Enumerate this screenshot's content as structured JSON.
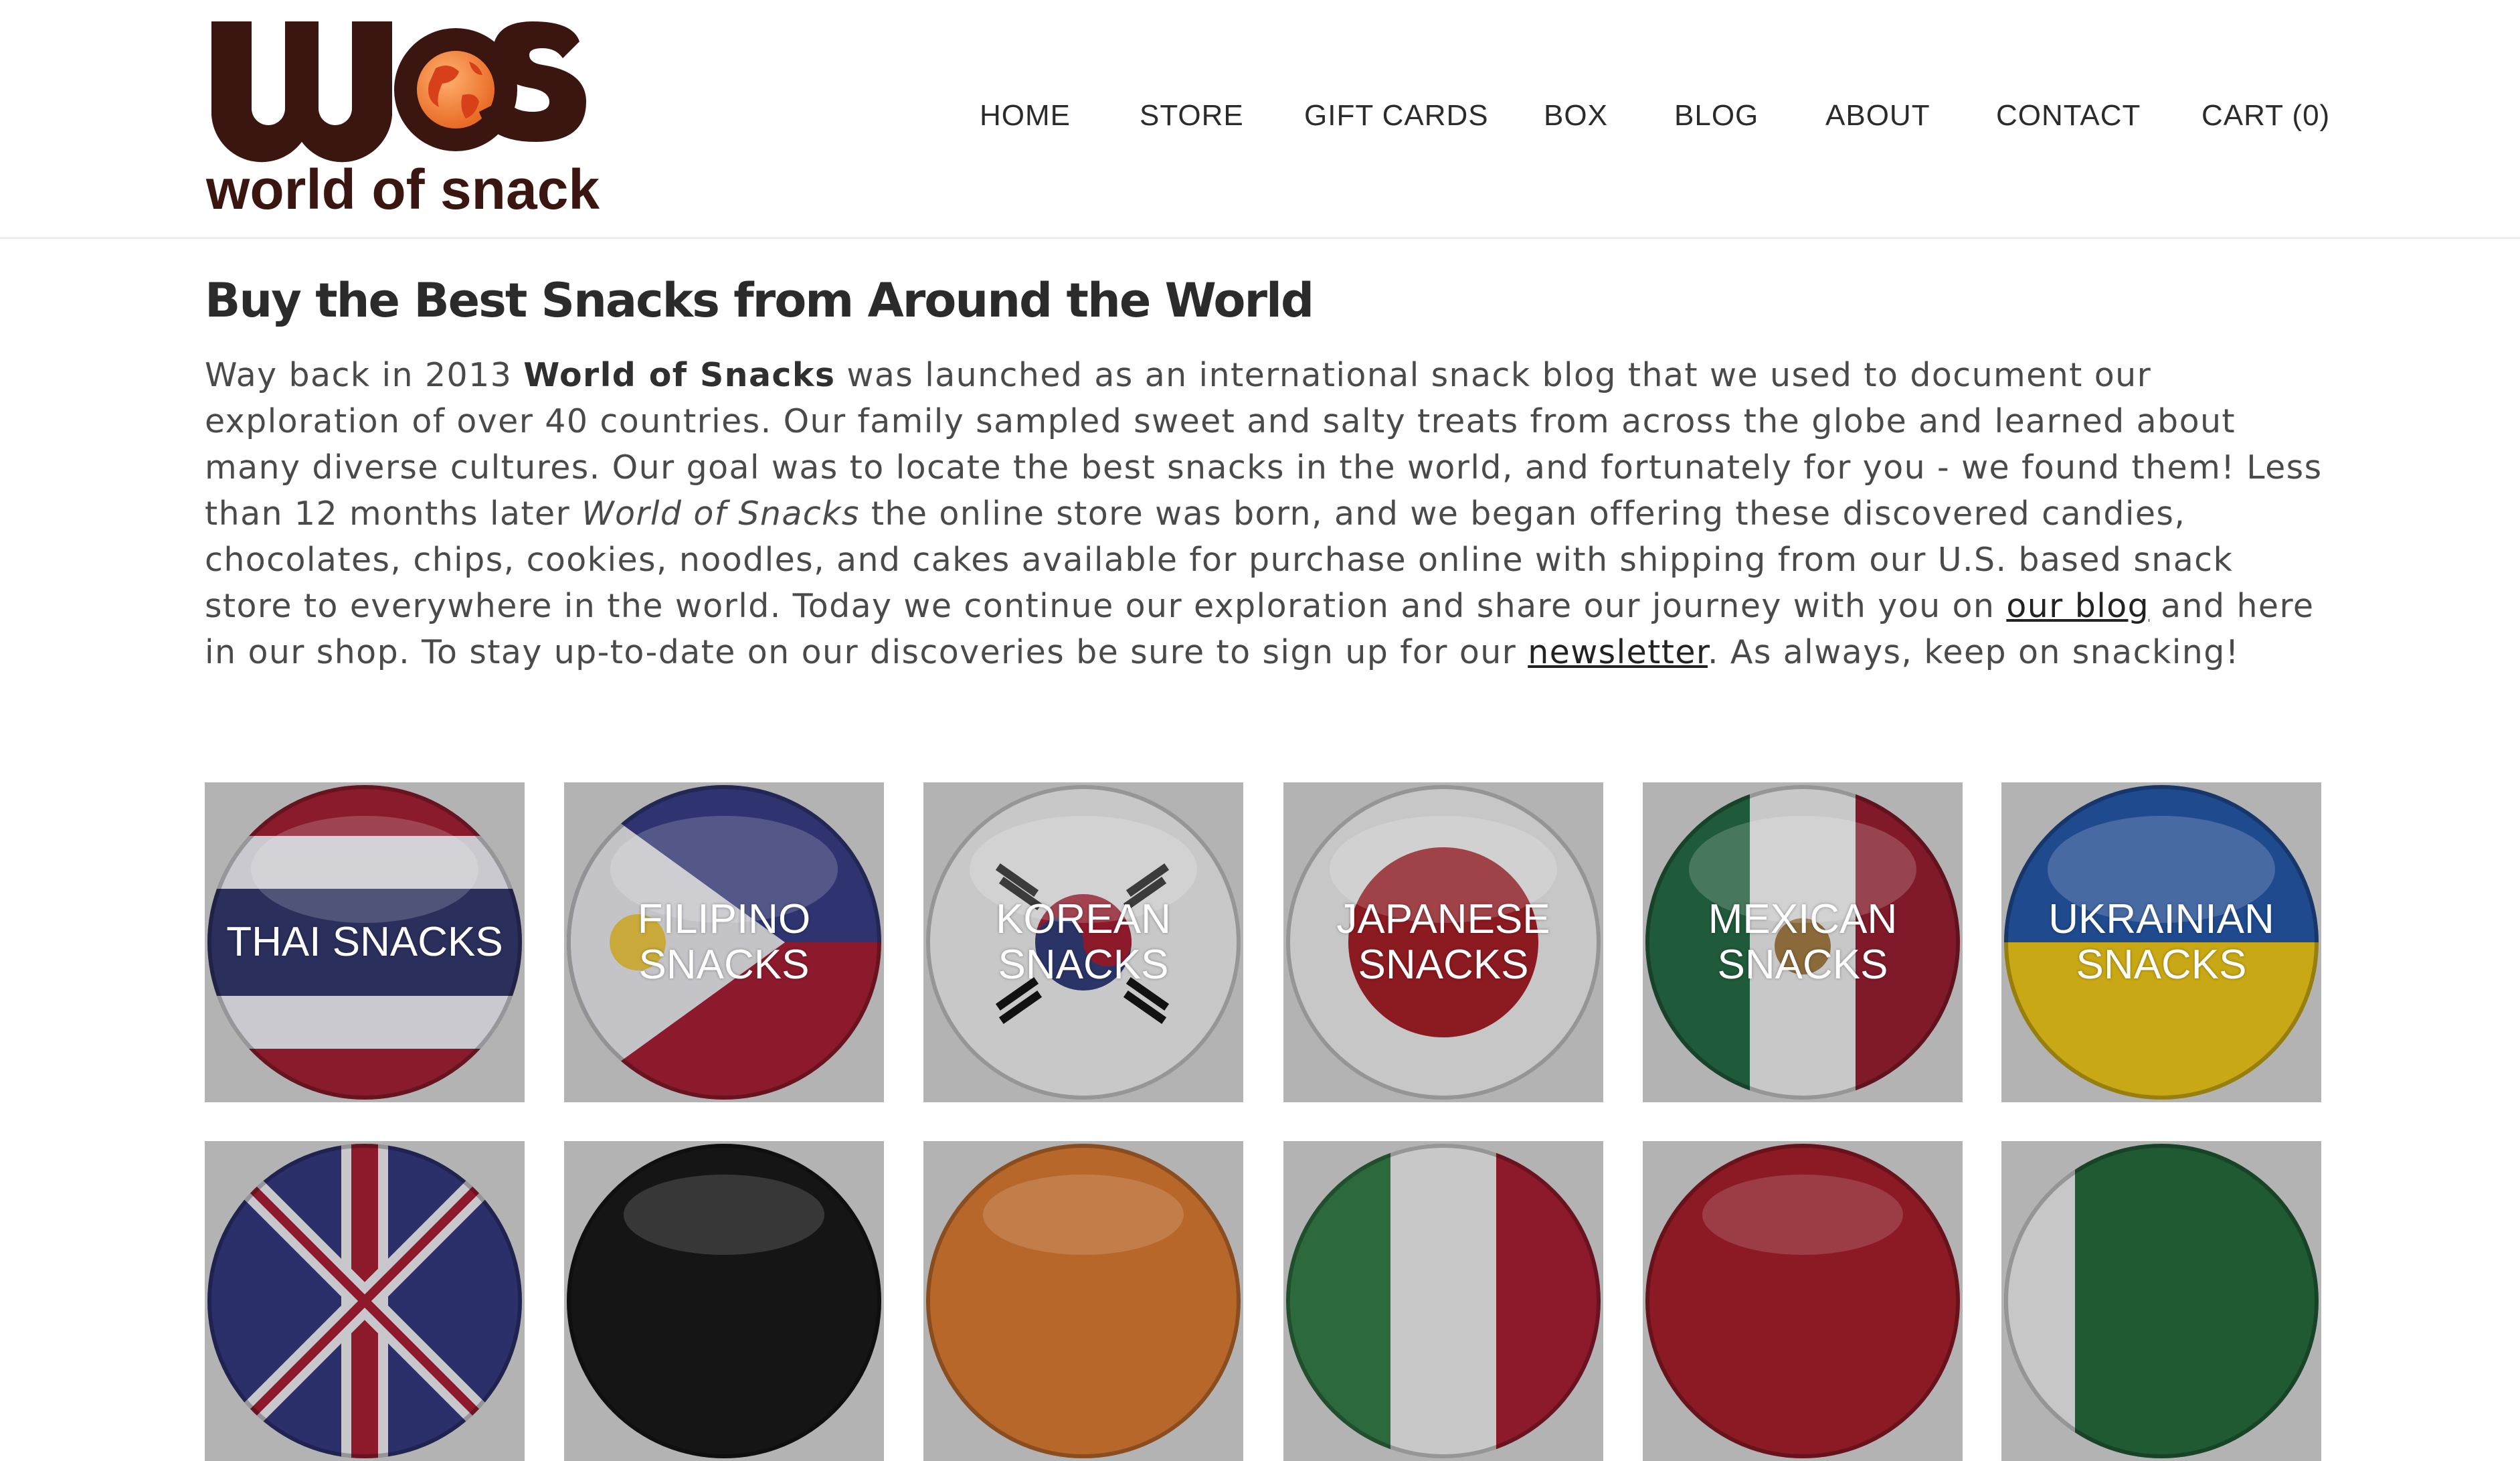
{
  "brand": {
    "logo_letters": "WOS",
    "logo_name": "world of snacks",
    "colors": {
      "primary": "#3b1510",
      "globe": "#ee7a2d",
      "land": "#d8401a"
    }
  },
  "nav": {
    "items": [
      "HOME",
      "STORE",
      "GIFT CARDS",
      "BOX",
      "BLOG",
      "ABOUT",
      "CONTACT",
      "CART (0)"
    ]
  },
  "main": {
    "title": "Buy the Best Snacks from Around the World",
    "intro": {
      "p1": "Way back in 2013 ",
      "bold": "World of Snacks",
      "p2": " was launched as an international snack blog that we used to document our exploration of over 40 countries.  Our family sampled sweet and salty treats from across the globe and learned about many diverse cultures. Our goal was to locate the best snacks in the world, and fortunately for you - we found them! Less than 12 months later  ",
      "italic": "World of Snacks",
      "p3": " the online store was born, and we began offering these discovered candies, chocolates, chips, cookies, noodles, and cakes available for purchase online with shipping from our U.S. based snack store to everywhere in the world. Today we continue our exploration and share our journey with you on ",
      "link_blog": "our blog",
      "p4": " and here in our shop.  To stay up-to-date on our discoveries be sure to sign up for our ",
      "link_newsletter": "newsletter",
      "p5": ". As always, keep on snacking!"
    }
  },
  "categories": [
    {
      "label": "THAI SNACKS",
      "icon": "thailand-flag-icon"
    },
    {
      "label": "FILIPINO SNACKS",
      "icon": "philippines-flag-icon"
    },
    {
      "label": "KOREAN SNACKS",
      "icon": "south-korea-flag-icon"
    },
    {
      "label": "JAPANESE SNACKS",
      "icon": "japan-flag-icon"
    },
    {
      "label": "MEXICAN SNACKS",
      "icon": "mexico-flag-icon"
    },
    {
      "label": "UKRAINIAN SNACKS",
      "icon": "ukraine-flag-icon"
    }
  ],
  "categories_row2": [
    {
      "icon": "united-kingdom-flag-icon"
    },
    {
      "icon": "black-flag-icon"
    },
    {
      "icon": "orange-flag-icon"
    },
    {
      "icon": "italy-flag-icon"
    },
    {
      "icon": "red-flag-icon"
    },
    {
      "icon": "green-flag-icon"
    }
  ]
}
